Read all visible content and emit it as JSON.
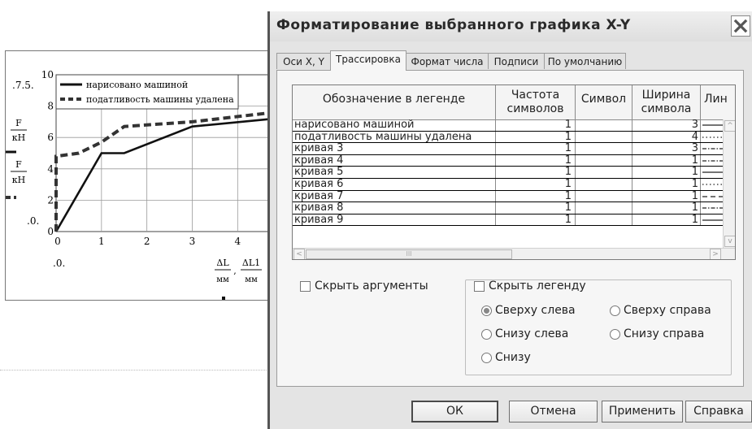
{
  "background_plot": {
    "y_ticks": [
      "0",
      "2",
      "4",
      "6",
      "8",
      "10"
    ],
    "x_ticks": [
      "0",
      "1",
      "2",
      "3",
      "4"
    ],
    "marker_top": ".7.5.",
    "marker_bottom": ".0.",
    "marker_x": ".0.",
    "y_label_f": "F",
    "y_label_unit": "кН",
    "x_label_left_top": "ΔL",
    "x_label_right_top": "ΔL1",
    "x_label_unit": "мм",
    "x_label_comma": ",",
    "legend": [
      "нарисовано машиной",
      "податливость машины удалена"
    ],
    "chart_data": {
      "type": "line",
      "xlim": [
        0,
        4.8
      ],
      "ylim": [
        0,
        10
      ],
      "series": [
        {
          "name": "нарисовано машиной",
          "style": "solid",
          "x": [
            0,
            1,
            1.5,
            3,
            4.8
          ],
          "y": [
            0,
            5,
            5,
            6.7,
            7.2
          ]
        },
        {
          "name": "податливость машины удалена",
          "style": "dashed",
          "x": [
            0,
            0,
            0.5,
            1,
            1.5,
            3,
            4.8
          ],
          "y": [
            0,
            4.8,
            5,
            5.7,
            6.7,
            7,
            7.6
          ]
        }
      ]
    }
  },
  "dialog": {
    "title": "Форматирование выбранного графика X-Y",
    "close_glyph": "X",
    "tabs": [
      {
        "label": "Оси X, Y",
        "active": false
      },
      {
        "label": "Трассировка",
        "active": true
      },
      {
        "label": "Формат числа",
        "active": false
      },
      {
        "label": "Подписи",
        "active": false
      },
      {
        "label": "По умолчанию",
        "active": false
      }
    ],
    "grid": {
      "columns": [
        {
          "label": "Обозначение в легенде"
        },
        {
          "label": "Частота символов"
        },
        {
          "label": "Символ"
        },
        {
          "label": "Ширина символа"
        },
        {
          "label": "Лин"
        }
      ],
      "rows": [
        {
          "name": "нарисовано машиной",
          "freq": "1",
          "symbol": "",
          "width": "3",
          "line": "solid"
        },
        {
          "name": "податливость машины удалена",
          "freq": "1",
          "symbol": "",
          "width": "4",
          "line": "dotted"
        },
        {
          "name": "кривая 3",
          "freq": "1",
          "symbol": "",
          "width": "3",
          "line": "dashdot"
        },
        {
          "name": "кривая 4",
          "freq": "1",
          "symbol": "",
          "width": "1",
          "line": "dashdot"
        },
        {
          "name": "кривая 5",
          "freq": "1",
          "symbol": "",
          "width": "1",
          "line": "solid"
        },
        {
          "name": "кривая 6",
          "freq": "1",
          "symbol": "",
          "width": "1",
          "line": "dotted"
        },
        {
          "name": "кривая 7",
          "freq": "1",
          "symbol": "",
          "width": "1",
          "line": "dashed"
        },
        {
          "name": "кривая 8",
          "freq": "1",
          "symbol": "",
          "width": "1",
          "line": "dashdot"
        },
        {
          "name": "кривая 9",
          "freq": "1",
          "symbol": "",
          "width": "1",
          "line": "solid"
        }
      ],
      "scroll_up": "^",
      "scroll_down": "v",
      "scroll_left": "<",
      "scroll_right": ">",
      "hthumb_grip": "III"
    },
    "hide_arguments": {
      "label": "Скрыть аргументы",
      "checked": false
    },
    "hide_legend": {
      "label": "Скрыть легенду",
      "checked": false
    },
    "legend_positions": [
      {
        "label": "Сверху слева",
        "checked": true
      },
      {
        "label": "Сверху справа",
        "checked": false
      },
      {
        "label": "Снизу слева",
        "checked": false
      },
      {
        "label": "Снизу справа",
        "checked": false
      },
      {
        "label": "Снизу",
        "checked": false
      }
    ],
    "buttons": {
      "ok": "ОК",
      "cancel": "Отмена",
      "apply": "Применить",
      "help": "Справка"
    }
  }
}
